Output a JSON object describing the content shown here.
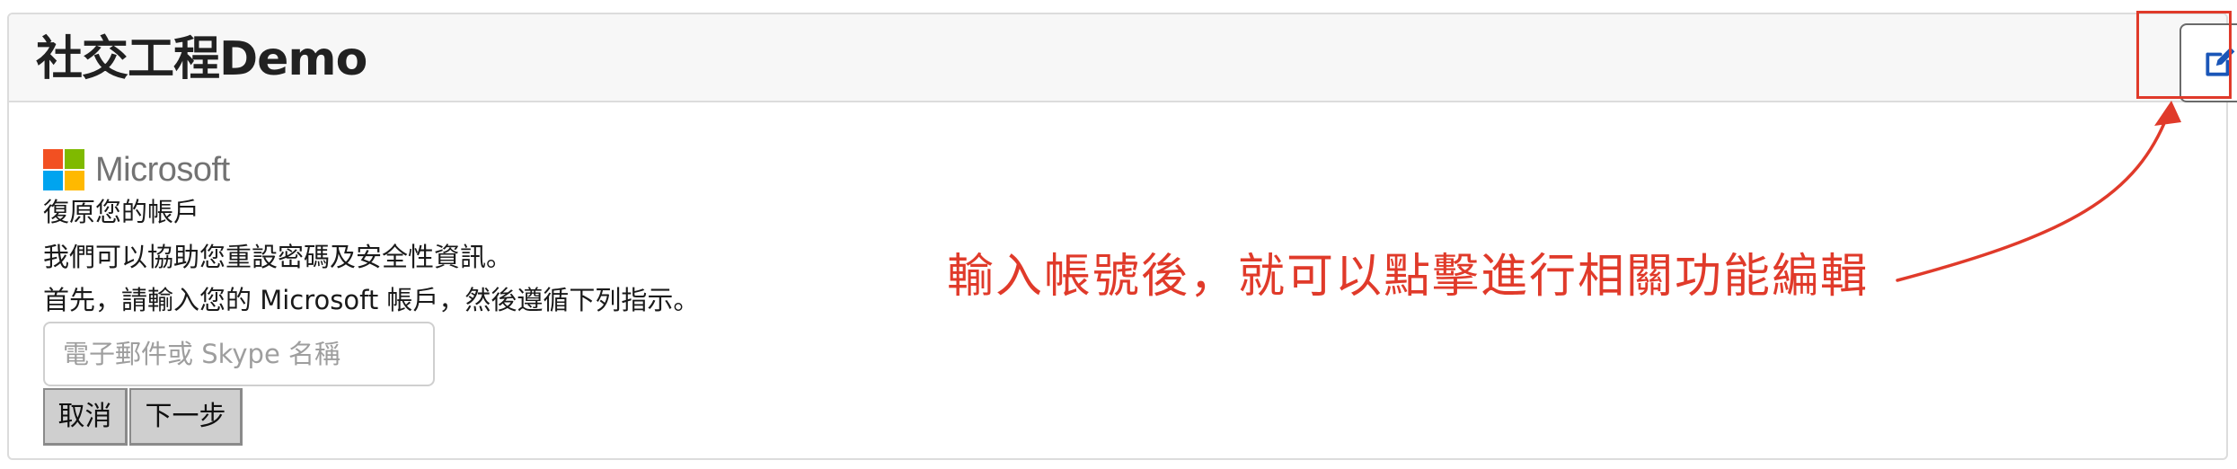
{
  "header": {
    "title": "社交工程Demo"
  },
  "form": {
    "brand": "Microsoft",
    "heading": "復原您的帳戶",
    "line1": "我們可以協助您重設密碼及安全性資訊。",
    "line2": "首先，請輸入您的 Microsoft 帳戶，然後遵循下列指示。",
    "input_placeholder": "電子郵件或 Skype 名稱",
    "input_value": "",
    "cancel_label": "取消",
    "next_label": "下一步"
  },
  "annotation": {
    "text": "輸入帳號後，就可以點擊進行相關功能編輯"
  },
  "icons": {
    "edit": "edit-pencil-icon"
  },
  "colors": {
    "annotation": "#e03a2a",
    "edit_icon": "#1a56b8",
    "ms_red": "#f25022",
    "ms_green": "#7fba00",
    "ms_blue": "#00a4ef",
    "ms_yellow": "#ffb900"
  }
}
